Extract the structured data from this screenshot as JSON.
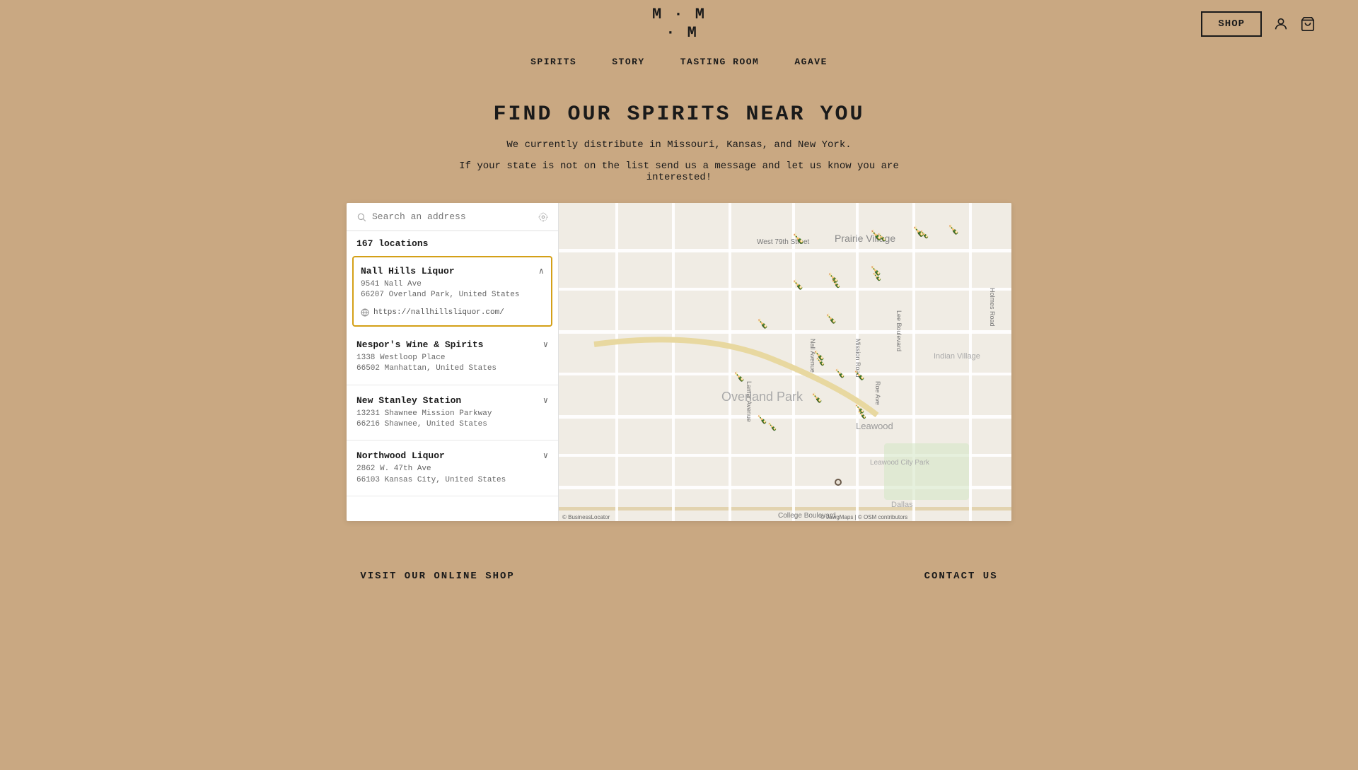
{
  "header": {
    "logo_line1": "M·M",
    "logo_line2": "·M",
    "logo_full": "M · M\n· M",
    "shop_label": "SHOP"
  },
  "nav": {
    "items": [
      {
        "label": "SPIRITS"
      },
      {
        "label": "STORY"
      },
      {
        "label": "TASTING ROOM"
      },
      {
        "label": "AGAVE"
      }
    ]
  },
  "main": {
    "page_title": "FIND OUR SPIRITS NEAR YOU",
    "subtitle": "We currently distribute in Missouri, Kansas, and New York.",
    "subtitle2_line1": "If your state is not on the list send us a message and let us know you are",
    "subtitle2_line2": "interested!"
  },
  "store_finder": {
    "search_placeholder": "Search an address",
    "locations_count": "167 locations",
    "locations": [
      {
        "name": "Nall Hills Liquor",
        "address_line1": "9541 Nall Ave",
        "address_line2": "66207 Overland Park, United States",
        "website": "https://nallhillsliquor.com/",
        "active": true
      },
      {
        "name": "Nespor's Wine & Spirits",
        "address_line1": "1338 Westloop Place",
        "address_line2": "66502 Manhattan, United States",
        "website": null,
        "active": false
      },
      {
        "name": "New Stanley Station",
        "address_line1": "13231 Shawnee Mission Parkway",
        "address_line2": "66216 Shawnee, United States",
        "website": null,
        "active": false
      },
      {
        "name": "Northwood Liquor",
        "address_line1": "2862 W. 47th Ave",
        "address_line2": "66103 Kansas City, United States",
        "website": null,
        "active": false
      }
    ]
  },
  "footer": {
    "col1_title": "VISIT OUR ONLINE SHOP",
    "col2_title": "CONTACT US"
  },
  "map": {
    "attribution": "© JawgMaps | © OSM contributors",
    "area_labels": [
      "Prairie Village",
      "Overland Park",
      "Leawood",
      "Indian Village",
      "Dallas",
      "Leawood City Park"
    ],
    "street_labels": [
      "West 79th Street",
      "College Boulevard",
      "Holmes Road",
      "Mission Road",
      "Nall Avenue",
      "Roe Ave"
    ]
  },
  "icons": {
    "search": "🔍",
    "location": "◎",
    "chevron_down": "∨",
    "chevron_up": "∧",
    "globe": "🌐",
    "user": "👤",
    "cart": "🛒",
    "bottle": "🍾"
  }
}
